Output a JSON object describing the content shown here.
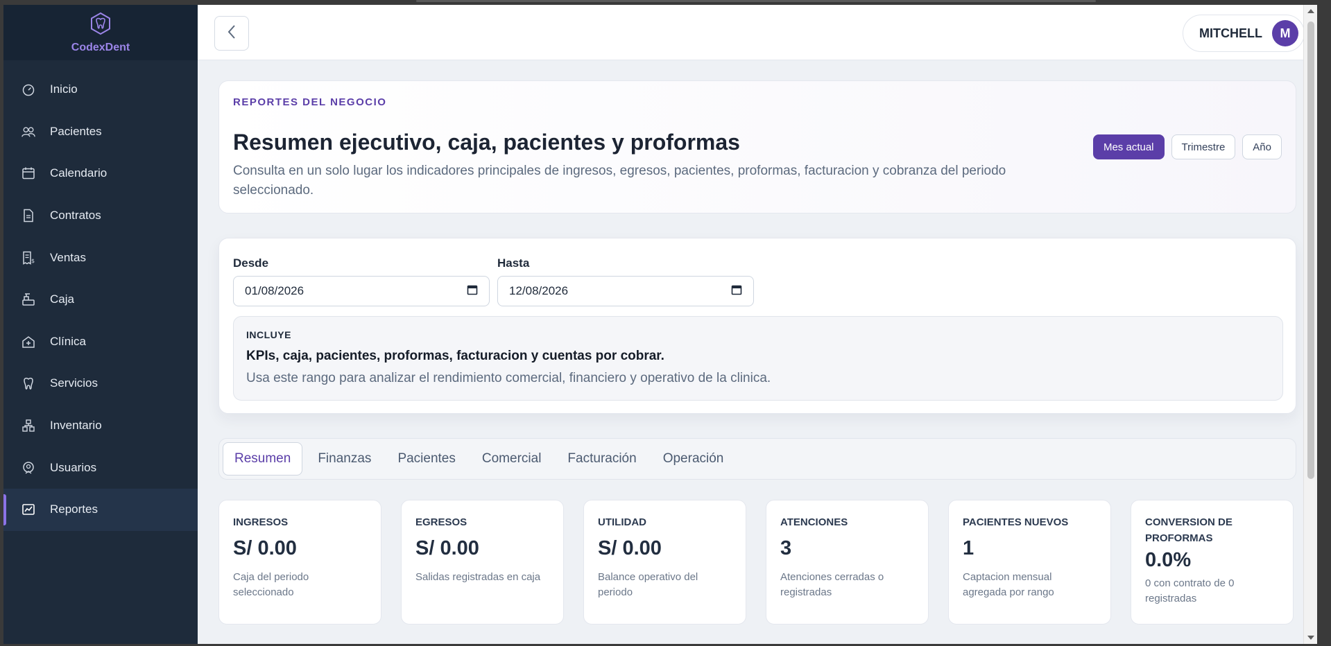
{
  "brand": {
    "name": "CodexDent"
  },
  "sidebar": {
    "items": [
      {
        "label": "Inicio",
        "icon": "dashboard-icon"
      },
      {
        "label": "Pacientes",
        "icon": "users-icon"
      },
      {
        "label": "Calendario",
        "icon": "calendar-icon"
      },
      {
        "label": "Contratos",
        "icon": "document-icon"
      },
      {
        "label": "Ventas",
        "icon": "receipt-icon"
      },
      {
        "label": "Caja",
        "icon": "cash-register-icon"
      },
      {
        "label": "Clínica",
        "icon": "clinic-icon"
      },
      {
        "label": "Servicios",
        "icon": "tooth-icon"
      },
      {
        "label": "Inventario",
        "icon": "boxes-icon"
      },
      {
        "label": "Usuarios",
        "icon": "user-shield-icon"
      },
      {
        "label": "Reportes",
        "icon": "chart-icon",
        "active": true
      }
    ]
  },
  "header": {
    "user_name": "MITCHELL",
    "avatar_initial": "M"
  },
  "hero": {
    "eyebrow": "REPORTES DEL NEGOCIO",
    "title": "Resumen ejecutivo, caja, pacientes y proformas",
    "description": "Consulta en un solo lugar los indicadores principales de ingresos, egresos, pacientes, proformas, facturacion y cobranza del periodo seleccionado.",
    "period_buttons": [
      "Mes actual",
      "Trimestre",
      "Año"
    ]
  },
  "filters": {
    "from_label": "Desde",
    "from_value": "01/08/2026",
    "to_label": "Hasta",
    "to_value": "12/08/2026",
    "includes": {
      "label": "INCLUYE",
      "title": "KPIs, caja, pacientes, proformas, facturacion y cuentas por cobrar.",
      "description": "Usa este rango para analizar el rendimiento comercial, financiero y operativo de la clinica."
    }
  },
  "tabs": [
    "Resumen",
    "Finanzas",
    "Pacientes",
    "Comercial",
    "Facturación",
    "Operación"
  ],
  "kpis": [
    {
      "title": "INGRESOS",
      "value": "S/ 0.00",
      "note": "Caja del periodo seleccionado"
    },
    {
      "title": "EGRESOS",
      "value": "S/ 0.00",
      "note": "Salidas registradas en caja"
    },
    {
      "title": "UTILIDAD",
      "value": "S/ 0.00",
      "note": "Balance operativo del periodo"
    },
    {
      "title": "ATENCIONES",
      "value": "3",
      "note": "Atenciones cerradas o registradas"
    },
    {
      "title": "PACIENTES NUEVOS",
      "value": "1",
      "note": "Captacion mensual agregada por rango"
    },
    {
      "title": "CONVERSION DE PROFORMAS",
      "value": "0.0%",
      "note": "0 con contrato de 0 registradas"
    }
  ],
  "colors": {
    "accent": "#5b3ea8",
    "sidebar_bg": "#1e2b3b"
  }
}
